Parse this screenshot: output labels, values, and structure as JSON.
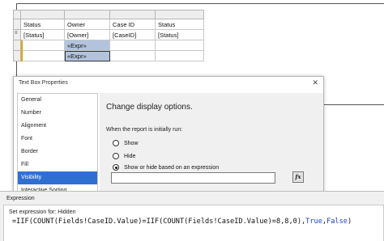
{
  "tablix": {
    "header": [
      "Status",
      "Owner",
      "Case ID",
      "Status"
    ],
    "detail": [
      "[Status]",
      "[Owner]",
      "[CaseID]",
      "[Status]"
    ],
    "expr_cells": [
      "«Expr»",
      "«Expr»"
    ]
  },
  "textbox_properties": {
    "title": "Text Box Properties",
    "nav": [
      "General",
      "Number",
      "Alignment",
      "Font",
      "Border",
      "Fill",
      "Visibility",
      "Interactive Sorting"
    ],
    "active_nav": "Visibility",
    "heading": "Change display options.",
    "prompt": "When the report is initially run:",
    "options": [
      "Show",
      "Hide",
      "Show or hide based on an expression"
    ],
    "selected_option": "Show or hide based on an expression",
    "expression_value": "",
    "fx_label": "fx"
  },
  "expression_dialog": {
    "title": "Expression",
    "set_label": "Set expression for: Hidden",
    "code_parts": {
      "a": "=IIF(COUNT(Fields!CaseID.Value)=IIF(COUNT(Fields!CaseID.Value)=8,8,0),",
      "t": "True",
      "c": ",",
      "f": "False",
      "z": ")"
    }
  },
  "colors": {
    "accent": "#2f6fd2",
    "expr_cell": "#b3c3dc",
    "keyword": "#1a3fd0"
  }
}
